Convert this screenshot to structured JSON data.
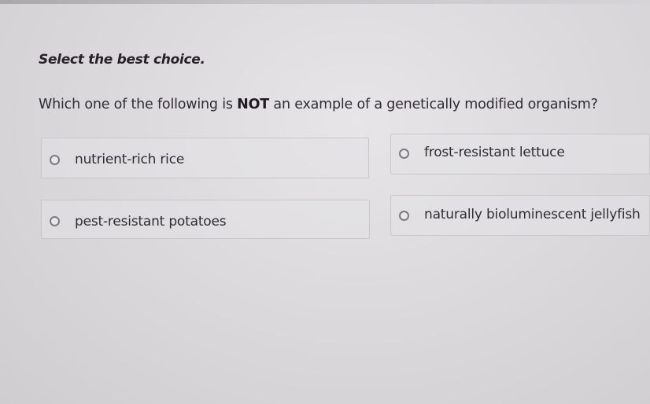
{
  "instruction": "Select the best choice.",
  "question": {
    "before": "Which one of the following is",
    "emphasis": "NOT",
    "after": "an example of a genetically modified organism?"
  },
  "choices": [
    {
      "label": "nutrient-rich rice",
      "selected": false
    },
    {
      "label": "frost-resistant lettuce",
      "selected": false
    },
    {
      "label": "pest-resistant potatoes",
      "selected": false
    },
    {
      "label": "naturally bioluminescent jellyfish",
      "selected": false
    }
  ],
  "icons": {
    "radio": "radio-unselected-icon"
  }
}
